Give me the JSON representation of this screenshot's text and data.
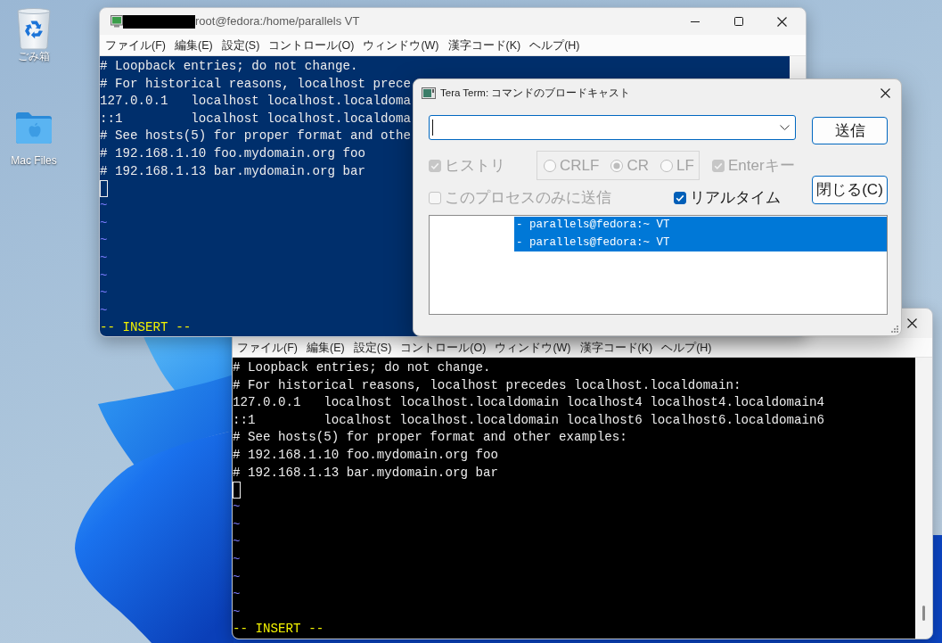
{
  "desktop": {
    "shortcuts": [
      {
        "kind": "recycle_bin",
        "label": "ごみ箱"
      },
      {
        "kind": "folder",
        "label": "Mac Files"
      }
    ]
  },
  "windows": [
    {
      "title": "root@fedora:/home/parallels VT",
      "title_redacted": true,
      "color": "#002f6c",
      "menu": [
        "ファイル(F)",
        "編集(E)",
        "設定(S)",
        "コントロール(O)",
        "ウィンドウ(W)",
        "漢字コード(K)",
        "ヘルプ(H)"
      ],
      "lines": [
        {
          "kind": "text",
          "text": "# Loopback entries; do not change."
        },
        {
          "kind": "text",
          "text": "# For historical reasons, localhost prece"
        },
        {
          "kind": "text",
          "text": "127.0.0.1   localhost localhost.localdoma"
        },
        {
          "kind": "text",
          "text": "::1         localhost localhost.localdoma"
        },
        {
          "kind": "text",
          "text": "# See hosts(5) for proper format and othe"
        },
        {
          "kind": "text",
          "text": "# 192.168.1.10 foo.mydomain.org foo"
        },
        {
          "kind": "text",
          "text": "# 192.168.1.13 bar.mydomain.org bar"
        },
        {
          "kind": "cursor"
        },
        {
          "kind": "tilde",
          "text": "~"
        },
        {
          "kind": "tilde",
          "text": "~"
        },
        {
          "kind": "tilde",
          "text": "~"
        },
        {
          "kind": "tilde",
          "text": "~"
        },
        {
          "kind": "tilde",
          "text": "~"
        },
        {
          "kind": "tilde",
          "text": "~"
        },
        {
          "kind": "tilde",
          "text": "~"
        }
      ],
      "status": "-- INSERT --"
    },
    {
      "color": "#000000",
      "menu": [
        "ファイル(F)",
        "編集(E)",
        "設定(S)",
        "コントロール(O)",
        "ウィンドウ(W)",
        "漢字コード(K)",
        "ヘルプ(H)"
      ],
      "lines": [
        {
          "kind": "text",
          "text": "# Loopback entries; do not change."
        },
        {
          "kind": "text",
          "text": "# For historical reasons, localhost precedes localhost.localdomain:"
        },
        {
          "kind": "text",
          "text": "127.0.0.1   localhost localhost.localdomain localhost4 localhost4.localdomain4"
        },
        {
          "kind": "text",
          "text": "::1         localhost localhost.localdomain localhost6 localhost6.localdomain6"
        },
        {
          "kind": "text",
          "text": "# See hosts(5) for proper format and other examples:"
        },
        {
          "kind": "text",
          "text": "# 192.168.1.10 foo.mydomain.org foo"
        },
        {
          "kind": "text",
          "text": "# 192.168.1.13 bar.mydomain.org bar"
        },
        {
          "kind": "cursor"
        },
        {
          "kind": "tilde",
          "text": "~"
        },
        {
          "kind": "tilde",
          "text": "~"
        },
        {
          "kind": "tilde",
          "text": "~"
        },
        {
          "kind": "tilde",
          "text": "~"
        },
        {
          "kind": "tilde",
          "text": "~"
        },
        {
          "kind": "tilde",
          "text": "~"
        },
        {
          "kind": "tilde",
          "text": "~"
        }
      ],
      "status": "-- INSERT --"
    }
  ],
  "dialog": {
    "title": "Tera Term: コマンドのブロードキャスト",
    "send_button": "送信",
    "close_button": "閉じる(C)",
    "history": {
      "label": "ヒストリ",
      "checked": true,
      "disabled": true
    },
    "line_endings": [
      {
        "label": "CRLF",
        "selected": false,
        "disabled": true
      },
      {
        "label": "CR",
        "selected": true,
        "disabled": true
      },
      {
        "label": "LF",
        "selected": false,
        "disabled": true
      }
    ],
    "enter_key": {
      "label": "Enterキー",
      "checked": true,
      "disabled": true
    },
    "this_process_only": {
      "label": "このプロセスのみに送信",
      "checked": false,
      "disabled": true
    },
    "realtime": {
      "label": "リアルタイム",
      "checked": true,
      "disabled": false
    },
    "window_list": [
      {
        "text": "- parallels@fedora:~ VT",
        "selected": true
      },
      {
        "text": "- parallels@fedora:~ VT",
        "selected": true
      }
    ]
  }
}
